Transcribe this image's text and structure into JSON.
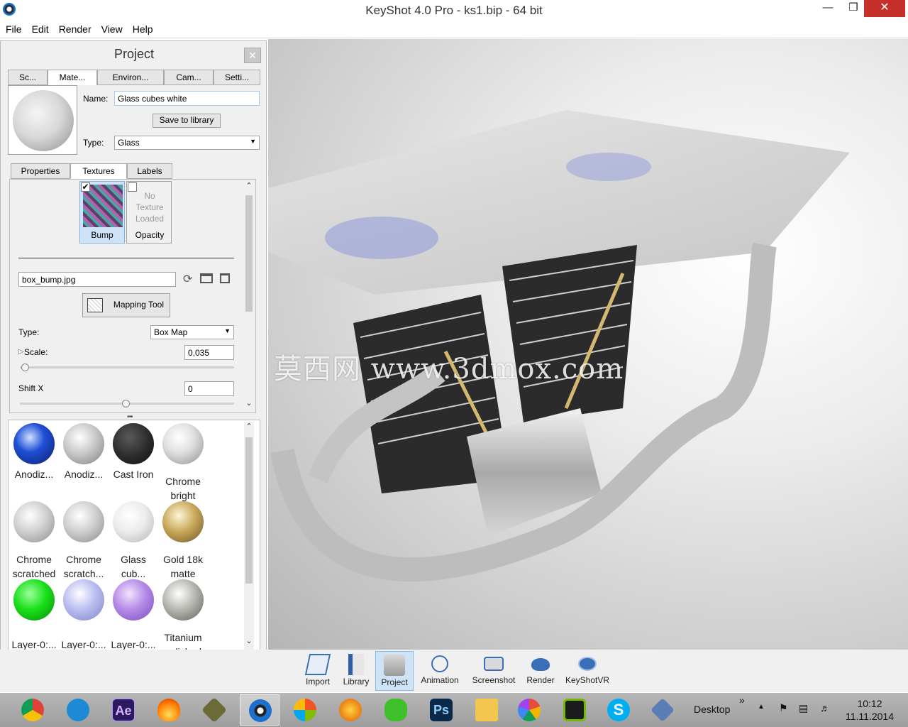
{
  "window": {
    "title": "KeyShot 4.0 Pro  - ks1.bip  - 64 bit",
    "min": "—",
    "max": "❒",
    "close": "✕"
  },
  "menu": [
    "File",
    "Edit",
    "Render",
    "View",
    "Help"
  ],
  "panel": {
    "title": "Project",
    "close": "✕",
    "tabs": [
      "Sc...",
      "Mate...",
      "Environ...",
      "Cam...",
      "Setti..."
    ],
    "name_label": "Name:",
    "name_value": "Glass cubes white",
    "save_button": "Save to library",
    "type_label": "Type:",
    "type_value": "Glass",
    "subtabs": [
      "Properties",
      "Textures",
      "Labels"
    ],
    "textures": {
      "bump_label": "Bump",
      "bump_checked": "✔",
      "opacity_label": "Opacity",
      "no_texture": [
        "No",
        "Texture",
        "Loaded"
      ],
      "file_value": "box_bump.jpg",
      "mapping_tool": "Mapping Tool",
      "map_type_label": "Type:",
      "map_type_value": "Box Map",
      "scale_arrow": "▷",
      "scale_label": "Scale:",
      "scale_value": "0,035",
      "shift_x_label": "Shift X",
      "shift_x_value": "0"
    },
    "library": [
      {
        "line1": "Anodiz...",
        "line2": "",
        "color": "#1f4fd6"
      },
      {
        "line1": "Anodiz...",
        "line2": "",
        "color": "#c8c8c8"
      },
      {
        "line1": "Cast Iron",
        "line2": "",
        "color": "#2a2a2a"
      },
      {
        "line1": "Chrome",
        "line2": "bright",
        "color": "#e2e2e2"
      },
      {
        "line1": "Chrome",
        "line2": "scratched",
        "color": "#d0d0d0"
      },
      {
        "line1": "Chrome",
        "line2": "scratch...",
        "color": "#cfcfcf"
      },
      {
        "line1": "Glass",
        "line2": "cub...",
        "color": "#ececec"
      },
      {
        "line1": "Gold 18k",
        "line2": "matte",
        "color": "#c9a85a"
      },
      {
        "line1": "Layer-0:...",
        "line2": "",
        "color": "#19e019"
      },
      {
        "line1": "Layer-0:...",
        "line2": "",
        "color": "#b9bdf0"
      },
      {
        "line1": "Layer-0:...",
        "line2": "",
        "color": "#b58ae6"
      },
      {
        "line1": "Titanium",
        "line2": "polished",
        "color": "#b6b6b0"
      }
    ]
  },
  "viewport": {
    "watermark": "莫西网 www.3dmox.com"
  },
  "toolbar": [
    "Import",
    "Library",
    "Project",
    "Animation",
    "Screenshot",
    "Render",
    "KeyShotVR"
  ],
  "taskbar": {
    "apps": [
      "chrome",
      "internet-explorer",
      "after-effects",
      "firefox-like",
      "unknown-app",
      "keyshot",
      "windows-media",
      "stamp-app",
      "frog-app",
      "photoshop",
      "file-explorer",
      "picasa",
      "nvidia",
      "skype",
      "chess-app"
    ],
    "ps_label": "Ps",
    "ae_label": "Ae",
    "s_label": "S",
    "desktop": "Desktop",
    "chevrons": "»",
    "time": "10:12",
    "date": "11.11.2014"
  }
}
